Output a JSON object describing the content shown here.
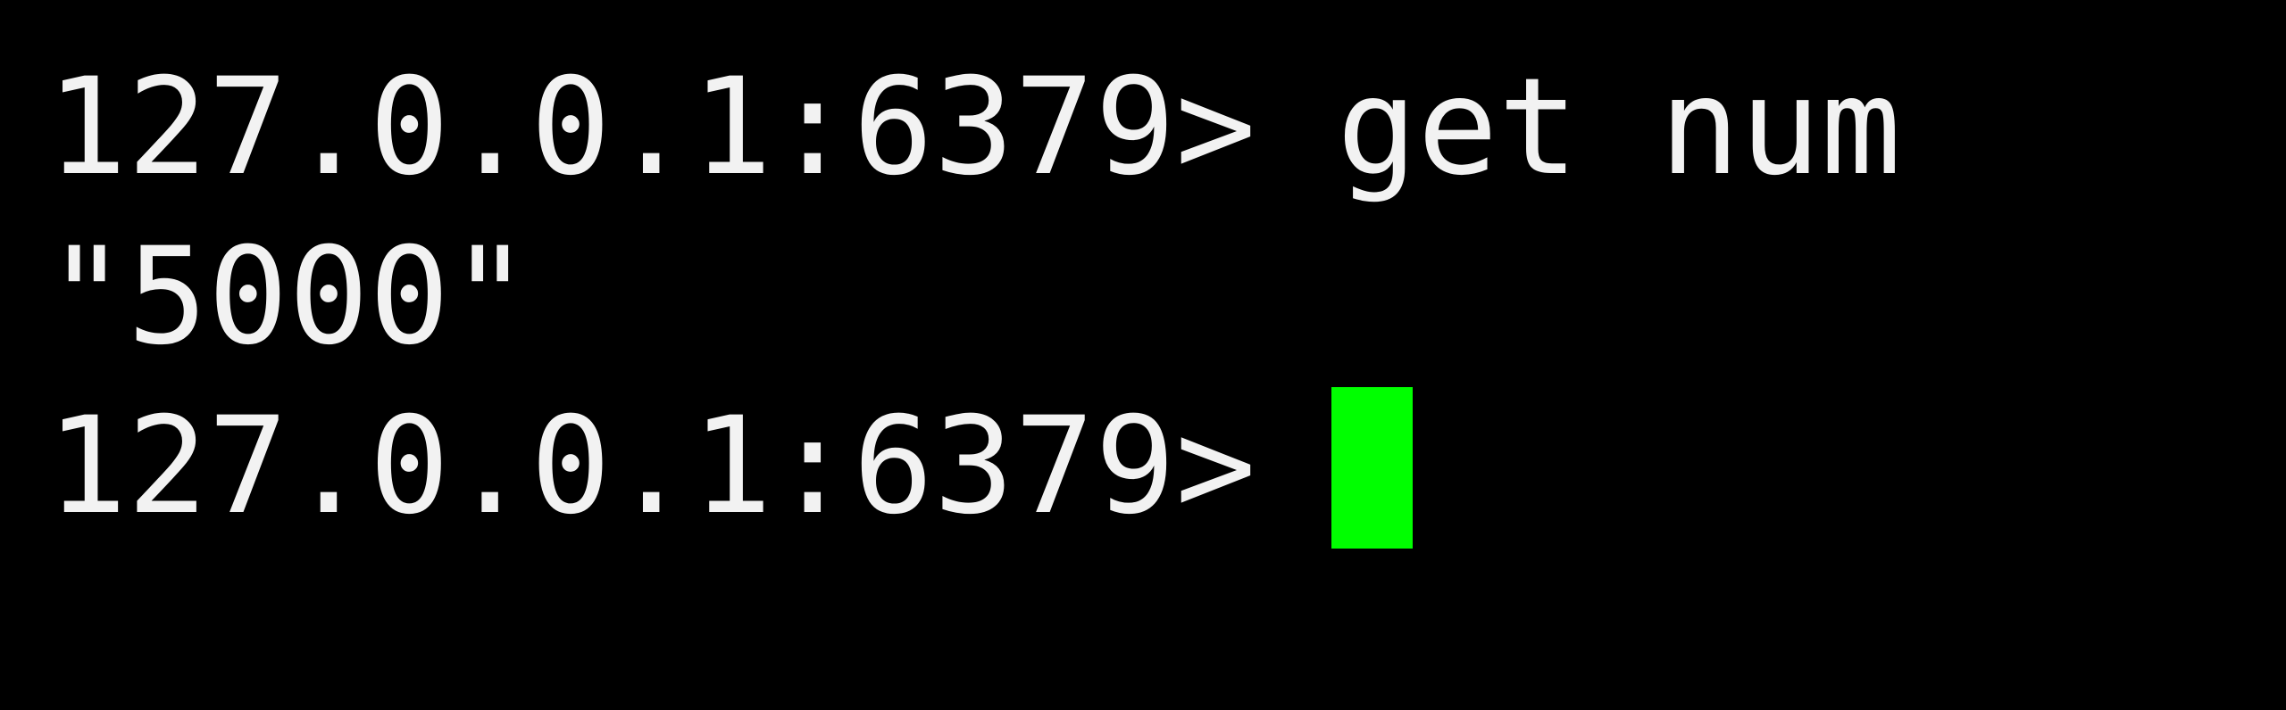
{
  "terminal": {
    "lines": [
      {
        "prompt": "127.0.0.1:6379>",
        "command": "get num"
      },
      {
        "output": "\"5000\""
      },
      {
        "prompt": "127.0.0.1:6379>",
        "command": ""
      }
    ],
    "cursor_color": "#00ff00",
    "text_color": "#f2f2f2",
    "background_color": "#000000"
  }
}
